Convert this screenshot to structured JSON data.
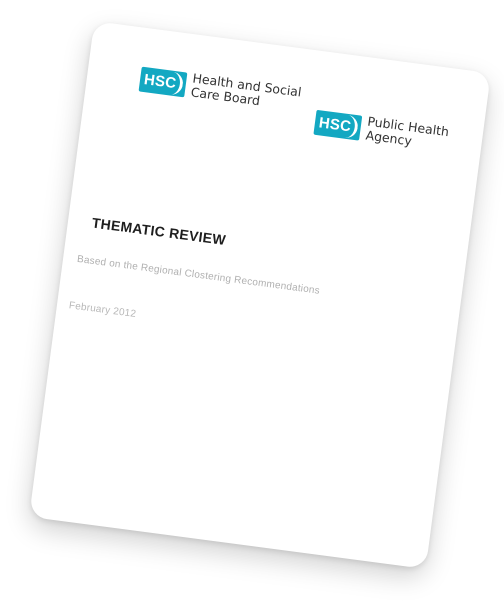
{
  "logos": [
    {
      "badge": "HSC",
      "name_lines": [
        "Health and Social",
        "Care Board"
      ],
      "color": "#13a8c2"
    },
    {
      "badge": "HSC",
      "name_lines": [
        "Public Health",
        "Agency"
      ],
      "color": "#13a8c2"
    }
  ],
  "document": {
    "title": "THEMATIC REVIEW",
    "subtitle": "Based on the Regional Clostering Recommendations",
    "date": "February 2012"
  }
}
